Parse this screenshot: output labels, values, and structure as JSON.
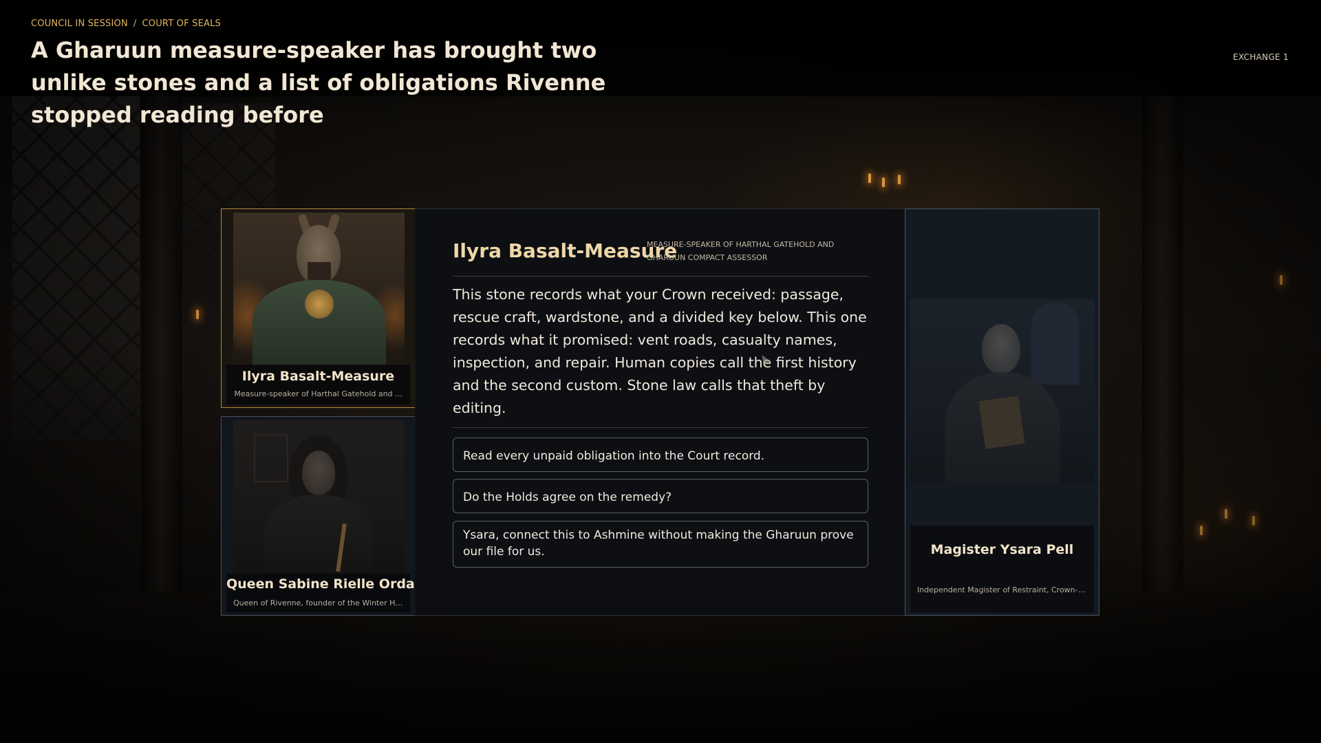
{
  "breadcrumb": {
    "items": [
      "COUNCIL IN SESSION",
      "COURT OF SEALS"
    ],
    "separator": "/"
  },
  "header": {
    "title": "A Gharuun measure-speaker has brought two unlike stones and a list of obligations Rivenne stopped reading before",
    "exchange": "EXCHANGE 1"
  },
  "participants": [
    {
      "name": "Ilyra Basalt-Measure",
      "subtitle": "Measure-speaker of Harthal Gatehold and ...",
      "active": true,
      "portrait_icon": "horned-gharuun-portrait"
    },
    {
      "name": "Queen Sabine Rielle Ordan",
      "subtitle": "Queen of Rivenne, founder of the Winter Ho...",
      "active": false,
      "portrait_icon": "queen-portrait"
    },
    {
      "name": "Magister Ysara Pell",
      "subtitle": "Independent Magister of Restraint, Crown-r...",
      "active": false,
      "portrait_icon": "magister-portrait"
    }
  ],
  "dialog": {
    "speaker_name": "Ilyra Basalt-Measure",
    "speaker_title": "MEASURE-SPEAKER OF HARTHAL GATEHOLD AND GHARUUN COMPACT ASSESSOR",
    "speech": "This stone records what your Crown received: passage, rescue craft, wardstone, and a divided key below. This one records what it promised: vent roads, casualty names, inspection, and repair. Human copies call the first history and the second custom. Stone law calls that theft by editing.",
    "choices": [
      "Read every unpaid obligation into the Court record.",
      "Do the Holds agree on the remedy?",
      "Ysara, connect this to Ashmine without making the Gharuun prove our file for us."
    ]
  },
  "colors": {
    "accent_gold": "#e2b55e",
    "active_border": "#b88a43",
    "panel_bg": "#0d0f13"
  }
}
